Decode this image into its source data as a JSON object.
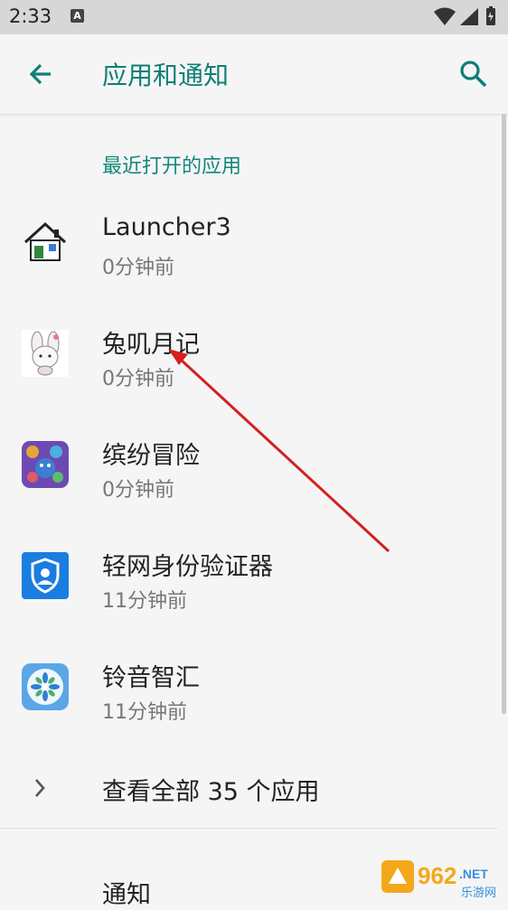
{
  "status_bar": {
    "time": "2:33",
    "badge": "A"
  },
  "toolbar": {
    "title": "应用和通知"
  },
  "recent": {
    "header": "最近打开的应用",
    "apps": [
      {
        "name": "Launcher3",
        "time": "0分钟前",
        "icon": "house-icon"
      },
      {
        "name": "兔叽月记",
        "time": "0分钟前",
        "icon": "bunny-icon"
      },
      {
        "name": "缤纷冒险",
        "time": "0分钟前",
        "icon": "game-icon"
      },
      {
        "name": "轻网身份验证器",
        "time": "11分钟前",
        "icon": "shield-user-icon"
      },
      {
        "name": "铃音智汇",
        "time": "11分钟前",
        "icon": "flower-icon"
      }
    ]
  },
  "see_all": {
    "label": "查看全部 35 个应用"
  },
  "notifications": {
    "label": "通知"
  },
  "watermark": {
    "number": "962",
    "suffix": ".NET",
    "sub": "乐游网"
  },
  "colors": {
    "accent": "#0e7f74",
    "annotation_arrow": "#d42020"
  }
}
